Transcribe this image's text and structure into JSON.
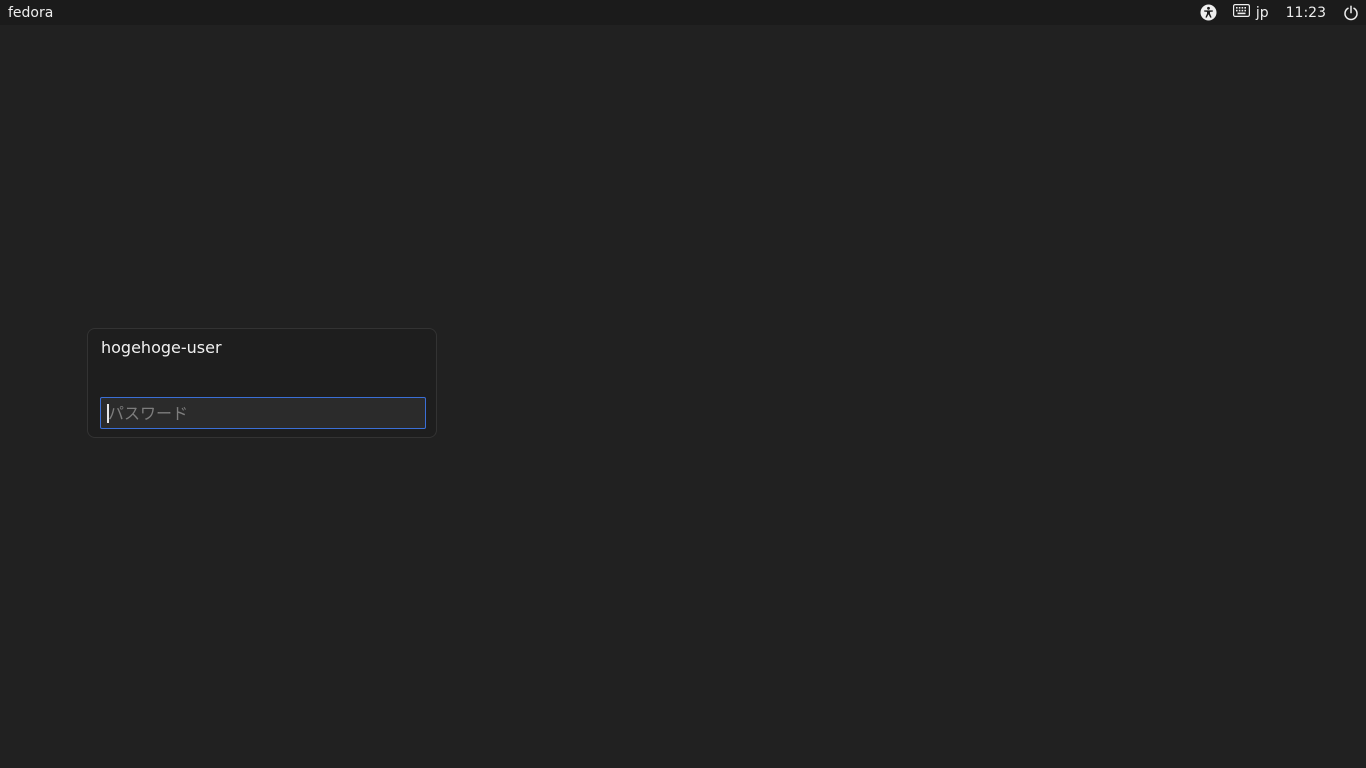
{
  "topbar": {
    "hostname": "fedora",
    "keyboard_layout": "jp",
    "clock": "11:23",
    "icons": {
      "accessibility": "accessibility-icon",
      "keyboard": "keyboard-icon",
      "power": "power-icon"
    }
  },
  "login": {
    "username": "hogehoge-user",
    "password_placeholder": "パスワード",
    "password_value": ""
  },
  "colors": {
    "background": "#212121",
    "topbar": "#1b1b1b",
    "focus_border": "#3b6fd6"
  }
}
